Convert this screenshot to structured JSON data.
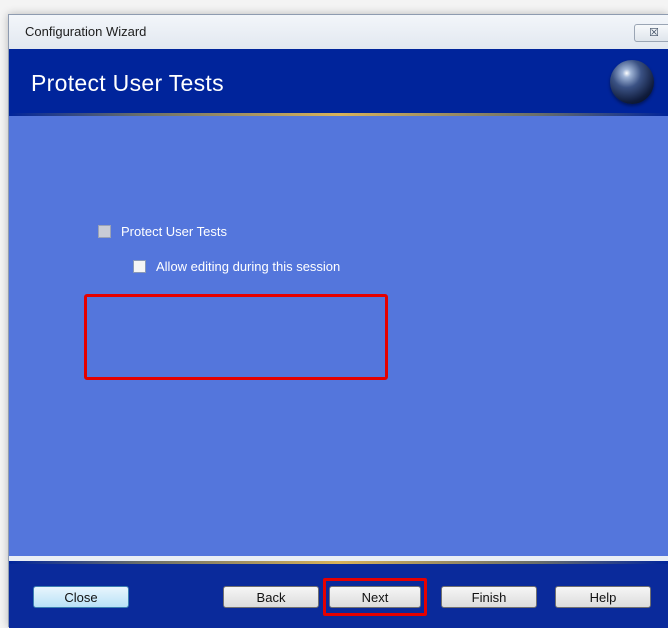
{
  "window": {
    "title": "Configuration Wizard",
    "close_glyph": "☒"
  },
  "header": {
    "title": "Protect User Tests",
    "logo_icon": "sphere-logo-icon"
  },
  "options": {
    "protect_label": "Protect User Tests",
    "protect_checked": false,
    "allow_editing_label": "Allow editing during this session",
    "allow_editing_checked": false
  },
  "buttons": {
    "close": "Close",
    "back": "Back",
    "next": "Next",
    "finish": "Finish",
    "help": "Help"
  },
  "colors": {
    "header": "#00249b",
    "content": "#5476dc",
    "footer": "#0a2a9b",
    "callout": "#e50000",
    "accent_line": "#d8b25a"
  }
}
